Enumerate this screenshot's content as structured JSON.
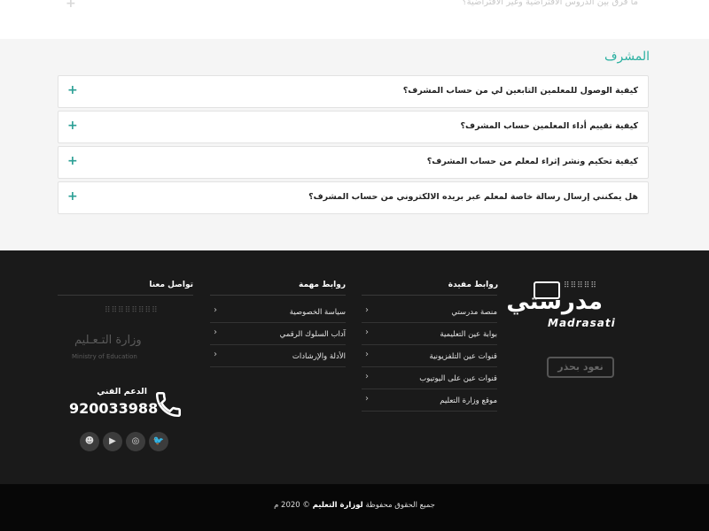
{
  "top": {
    "faded_question": "ما فرق بين الدروس الافتراضية وغير الافتراضية؟",
    "faded_plus": "+"
  },
  "section": {
    "title": "المشرف",
    "faq": [
      {
        "question": "كيفية الوصول للمعلمين التابعين لي من حساب المشرف؟",
        "icon": "+"
      },
      {
        "question": "كيفية تقييم أداء المعلمين حساب المشرف؟",
        "icon": "+"
      },
      {
        "question": "كيفية تحكيم ونشر إثراء لمعلم من حساب المشرف؟",
        "icon": "+"
      },
      {
        "question": "هل يمكنني إرسال رسالة خاصة لمعلم عبر بريده الالكتروني من حساب المشرف؟",
        "icon": "+"
      }
    ]
  },
  "footer": {
    "logo": {
      "arabic": "مدرستي",
      "latin": "Madrasati",
      "dots": "⠿⠿⠿⠿⠿"
    },
    "slogan": "نعود بحذر",
    "useful_links": {
      "title": "روابط مفيدة",
      "items": [
        "منصة مدرستي",
        "بوابة عين التعليمية",
        "قنوات عين التلفزيونية",
        "قنوات عين على اليوتيوب",
        "موقع وزارة التعليم"
      ]
    },
    "important_links": {
      "title": "روابط مهمة",
      "items": [
        "سياسة الخصوصية",
        "آداب السلوك الرقمي",
        "الأدلة والإرشادات"
      ]
    },
    "contact": {
      "title": "تواصل معنا",
      "ministry_ar": "وزارة التـعـليم",
      "ministry_en": "Ministry of Education",
      "pattern": "⠿⠿⠿⠿⠿⠿⠿⠿",
      "support_label": "الدعم الفني",
      "support_number": "920033988"
    },
    "social_icons": [
      "twitter-icon",
      "instagram-icon",
      "youtube-icon",
      "snapchat-icon"
    ],
    "social_glyphs": [
      "🐦",
      "◎",
      "▶",
      "☻"
    ],
    "copyright_pre": "جميع الحقوق محفوظة",
    "copyright_org": "لوزارة التعليم",
    "copyright_post": "© 2020 م"
  }
}
